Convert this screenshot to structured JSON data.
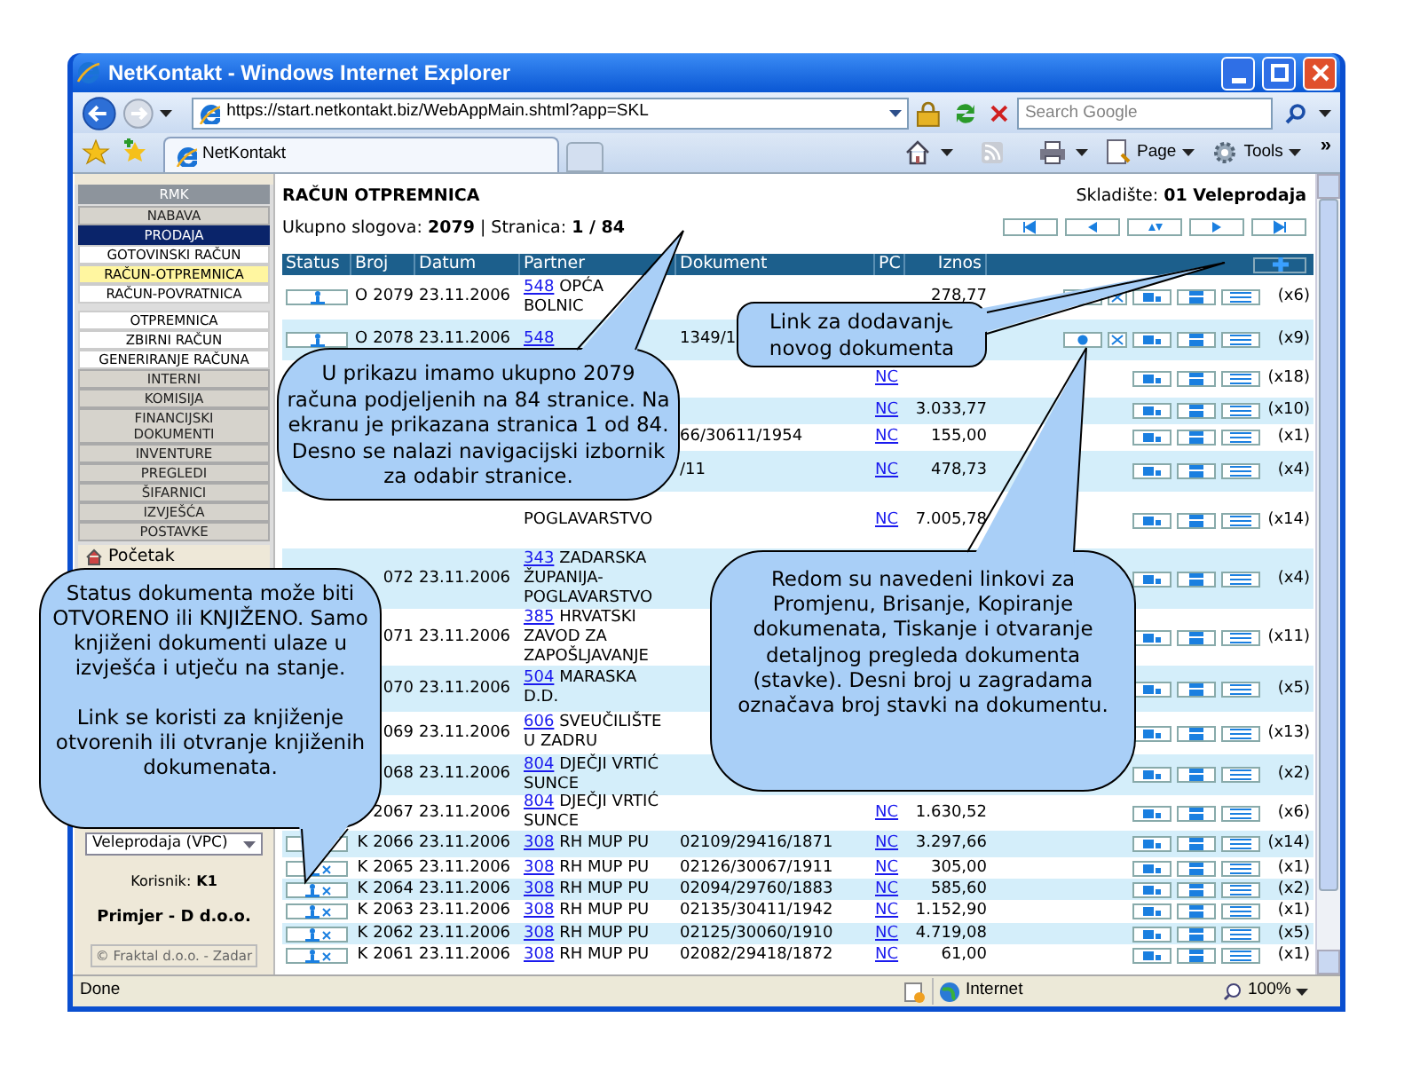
{
  "window": {
    "title": "NetKontakt - Windows Internet Explorer"
  },
  "address_bar": {
    "url": "https://start.netkontakt.biz/WebAppMain.shtml?app=SKL"
  },
  "search": {
    "placeholder": "Search Google"
  },
  "tabs": [
    {
      "label": "NetKontakt",
      "selected": true
    }
  ],
  "command_bar": {
    "items": [
      "Page",
      "Tools"
    ],
    "overflow": "»"
  },
  "sidebar": {
    "menu": [
      {
        "label": "RMK",
        "kind": "header"
      },
      {
        "label": "NABAVA",
        "kind": "group",
        "selected": false
      },
      {
        "label": "PRODAJA",
        "kind": "group",
        "selected": true,
        "children": [
          {
            "label": "GOTOVINSKI RAČUN",
            "selected": false
          },
          {
            "label": "RAČUN-OTPREMNICA",
            "selected": true
          },
          {
            "label": "RAČUN-POVRATNICA",
            "selected": false
          },
          {
            "label": "OTPREMNICA",
            "selected": false
          },
          {
            "label": "ZBIRNI RAČUN",
            "selected": false
          },
          {
            "label": "GENERIRANJE RAČUNA",
            "selected": false
          }
        ]
      },
      {
        "label": "INTERNI",
        "kind": "group",
        "selected": false
      },
      {
        "label": "KOMISIJA",
        "kind": "group",
        "selected": false
      },
      {
        "label": "FINANCIJSKI DOKUMENTI",
        "kind": "group",
        "selected": false
      },
      {
        "label": "INVENTURE",
        "kind": "group",
        "selected": false
      },
      {
        "label": "PREGLEDI",
        "kind": "group",
        "selected": false
      },
      {
        "label": "ŠIFARNICI",
        "kind": "group",
        "selected": false
      },
      {
        "label": "IZVJEŠĆA",
        "kind": "group",
        "selected": false
      },
      {
        "label": "POSTAVKE",
        "kind": "group",
        "selected": false
      },
      {
        "label": "Početak",
        "kind": "link"
      }
    ],
    "warehouse_select": "Veleprodaja (VPC)",
    "user_label": "Korisnik:",
    "user": "K1",
    "company": "Primjer - D d.o.o.",
    "copyright": "© Fraktal d.o.o. - Zadar"
  },
  "page": {
    "title": "RAČUN OTPREMNICA",
    "summary": "Ukupno slogova: **2079** | Stranica: **1 / 84**",
    "warehouse": "Skladište: **01 Veleprodaja**"
  },
  "table": {
    "columns": [
      "Status",
      "Broj",
      "Datum",
      "Partner",
      "Dokument",
      "PC",
      "Iznos"
    ],
    "rows": [
      {
        "kind": "open",
        "letter": "O",
        "number": "2079",
        "date": "23.11.2006",
        "partner_code": "548",
        "partner_name": "OPĆA BOLNIC",
        "amount": "278,77",
        "editable": true,
        "count": "(x6)"
      },
      {
        "kind": "open",
        "letter": "O",
        "number": "2078",
        "date": "23.11.2006",
        "partner_code": "548",
        "document": "1349/1",
        "editable": true,
        "count": "(x9)"
      },
      {
        "pc": "NC",
        "editable": false,
        "count": "(x18)"
      },
      {
        "pc": "NC",
        "amount": "3.033,77",
        "editable": false,
        "count": "(x10)"
      },
      {
        "document": "66/30611/1954",
        "pc": "NC",
        "amount": "155,00",
        "editable": false,
        "count": "(x1)"
      },
      {
        "document": "/11",
        "pc": "NC",
        "amount": "478,73",
        "editable": false,
        "count": "(x4)"
      },
      {
        "partner_name": "POGLAVARSTVO",
        "pc": "NC",
        "amount": "7.005,78",
        "editable": false,
        "count": "(x14)"
      },
      {
        "number": "072",
        "date": "23.11.2006",
        "partner_code": "343",
        "partner_name": "ZADARSKA ŽUPANIJA-POGLAVARSTVO",
        "editable": false,
        "count": "(x4)"
      },
      {
        "number": "071",
        "date": "23.11.2006",
        "partner_code": "385",
        "partner_name": "HRVATSKI ZAVOD ZA ZAPOŠLJAVANJE",
        "editable": false,
        "count": "(x11)"
      },
      {
        "number": "070",
        "date": "23.11.2006",
        "partner_code": "504",
        "partner_name": "MARASKA D.D.",
        "editable": false,
        "count": "(x5)"
      },
      {
        "number": "069",
        "date": "23.11.2006",
        "partner_code": "606",
        "partner_name": "SVEUČILIŠTE U ZADRU",
        "editable": false,
        "count": "(x13)"
      },
      {
        "number": "068",
        "date": "23.11.2006",
        "partner_code": "804",
        "partner_name": "DJEČJI VRTIĆ SUNCE",
        "editable": false,
        "count": "(x2)"
      },
      {
        "number": "2067",
        "date": "23.11.2006",
        "partner_code": "804",
        "partner_name": "DJEČJI VRTIĆ SUNCE",
        "pc": "NC",
        "amount": "1.630,52",
        "editable": false,
        "count": "(x6)"
      },
      {
        "kind": "booked",
        "letter": "K",
        "number": "2066",
        "date": "23.11.2006",
        "partner_code": "308",
        "partner_name": "RH MUP PU",
        "document": "02109/29416/1871",
        "pc": "NC",
        "amount": "3.297,66",
        "editable": false,
        "count": "(x14)"
      },
      {
        "kind": "booked",
        "letter": "K",
        "number": "2065",
        "date": "23.11.2006",
        "partner_code": "308",
        "partner_name": "RH MUP PU",
        "document": "02126/30067/1911",
        "pc": "NC",
        "amount": "305,00",
        "editable": false,
        "count": "(x1)"
      },
      {
        "kind": "booked",
        "letter": "K",
        "number": "2064",
        "date": "23.11.2006",
        "partner_code": "308",
        "partner_name": "RH MUP PU",
        "document": "02094/29760/1883",
        "pc": "NC",
        "amount": "585,60",
        "editable": false,
        "count": "(x2)"
      },
      {
        "kind": "booked",
        "letter": "K",
        "number": "2063",
        "date": "23.11.2006",
        "partner_code": "308",
        "partner_name": "RH MUP PU",
        "document": "02135/30411/1942",
        "pc": "NC",
        "amount": "1.152,90",
        "editable": false,
        "count": "(x1)"
      },
      {
        "kind": "booked",
        "letter": "K",
        "number": "2062",
        "date": "23.11.2006",
        "partner_code": "308",
        "partner_name": "RH MUP PU",
        "document": "02125/30060/1910",
        "pc": "NC",
        "amount": "4.719,08",
        "editable": false,
        "count": "(x5)"
      },
      {
        "kind": "booked",
        "letter": "K",
        "number": "2061",
        "date": "23.11.2006",
        "partner_code": "308",
        "partner_name": "RH MUP PU",
        "document": "02082/29418/1872",
        "pc": "NC",
        "amount": "61,00",
        "editable": false,
        "count": "(x1)"
      }
    ]
  },
  "callouts": [
    {
      "text": "U prikazu imamo ukupno 2079 računa podjeljenih na 84 stranice. Na ekranu je prikazana stranica 1 od 84. Desno se nalazi navigacijski izbornik za odabir stranice."
    },
    {
      "text": "Link za dodavanje novog dokumenta"
    },
    {
      "text": "Status dokumenta može biti OTVORENO ili KNJIŽENO. Samo knjiženi dokumenti ulaze u izvješća i utječu na stanje.\n\nLink se koristi za knjiženje otvorenih ili otvranje knjiženih dokumenata."
    },
    {
      "text": "Redom su navedeni linkovi za Promjenu, Brisanje, Kopiranje dokumenata, Tiskanje i otvaranje detaljnog pregleda dokumenta (stavke). Desni broj u zagradama označava broj stavki na dokumentu."
    }
  ],
  "status_bar": {
    "text": "Done",
    "zone": "Internet",
    "zoom": "100%"
  }
}
